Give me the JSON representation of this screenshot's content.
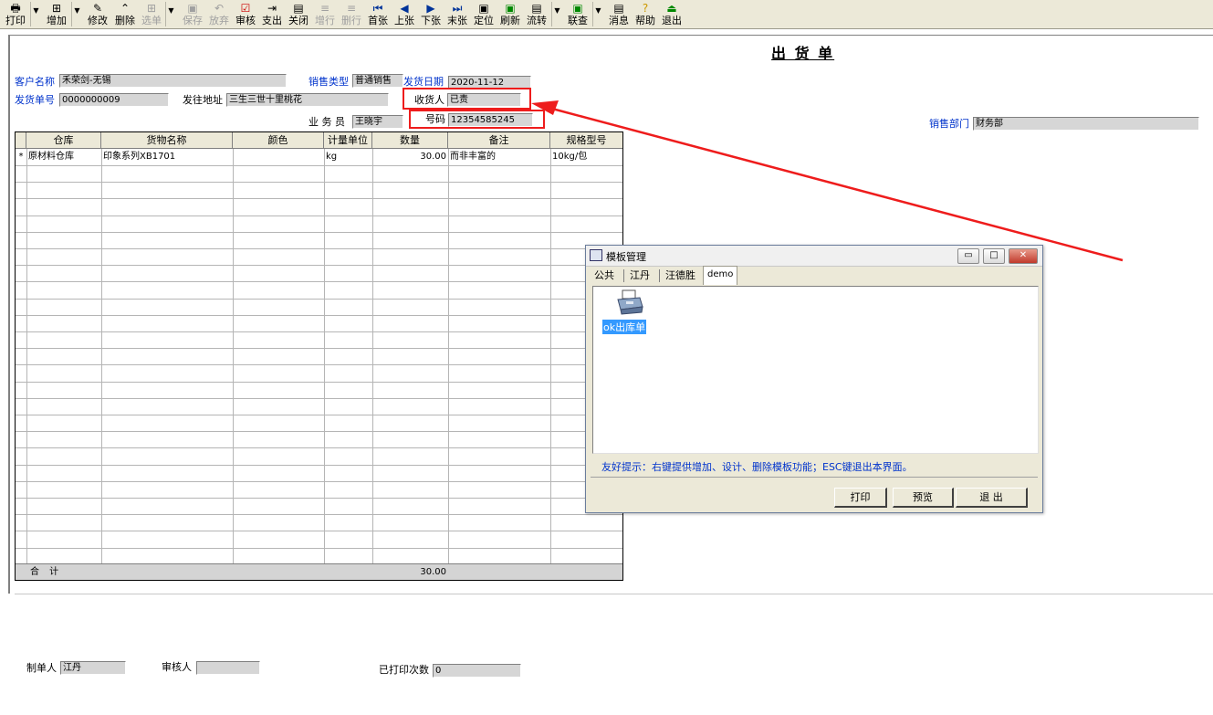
{
  "toolbar": {
    "print": "打印",
    "add": "增加",
    "edit": "修改",
    "delete": "删除",
    "select": "选单",
    "save": "保存",
    "discard": "放弃",
    "audit": "审核",
    "payout": "支出",
    "close": "关闭",
    "addrow": "增行",
    "delrow": "删行",
    "first": "首张",
    "prev": "上张",
    "next": "下张",
    "last": "末张",
    "locate": "定位",
    "refresh": "刷新",
    "flow": "流转",
    "link": "联查",
    "message": "消息",
    "help": "帮助",
    "exit": "退出"
  },
  "form": {
    "title": "出 货 单",
    "customer_label": "客户名称",
    "customer_value": "禾荣剑-无锡",
    "sales_type_label": "销售类型",
    "sales_type_value": "普通销售",
    "ship_date_label": "发货日期",
    "ship_date_value": "2020-11-12",
    "ship_no_label": "发货单号",
    "ship_no_value": "0000000009",
    "address_label": "发往地址",
    "address_value": "三生三世十里桃花",
    "receiver_label": "收货人",
    "receiver_value": "已责",
    "salesman_label": "业 务 员",
    "salesman_value": "王晓宇",
    "phone_label": "号码",
    "phone_value": "12354585245",
    "dept_label": "销售部门",
    "dept_value": "财务部"
  },
  "grid": {
    "headers": [
      "仓库",
      "货物名称",
      "颜色",
      "计量单位",
      "数量",
      "备注",
      "规格型号"
    ],
    "row_marker": "*",
    "rows": [
      {
        "warehouse": "原材料仓库",
        "goods": "印象系列XB1701",
        "color": "",
        "unit": "kg",
        "qty": "30.00",
        "remark": "而非丰富的",
        "spec": "10kg/包"
      }
    ],
    "total_label": "合 计",
    "total_qty": "30.00"
  },
  "footer": {
    "maker_label": "制单人",
    "maker_value": "江丹",
    "auditor_label": "审核人",
    "auditor_value": "",
    "printed_label": "已打印次数",
    "printed_value": "0"
  },
  "dialog": {
    "title": "模板管理",
    "tabs": [
      "公共",
      "江丹",
      "汪德胜",
      "demo"
    ],
    "item_label": "ok出库单",
    "hint": "友好提示：右键提供增加、设计、删除模板功能；ESC键退出本界面。",
    "print_button": "打印",
    "preview_button": "预览",
    "exit_button": "退 出"
  },
  "colors": {
    "accent_blue": "#0033cc",
    "highlight_red": "#ee1c1c",
    "selection": "#3399ff"
  }
}
